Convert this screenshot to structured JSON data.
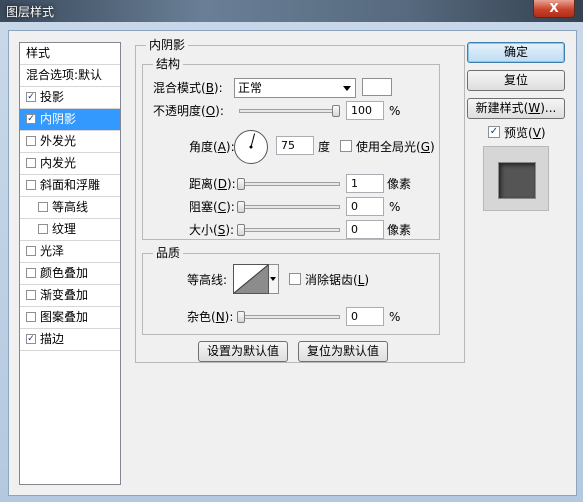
{
  "window": {
    "title": "图层样式",
    "close_label": "X"
  },
  "styles_list": {
    "header": "样式",
    "blend_options": "混合选项:默认",
    "items": [
      {
        "label": "投影",
        "checked": true
      },
      {
        "label": "内阴影",
        "checked": true,
        "selected": true
      },
      {
        "label": "外发光",
        "checked": false
      },
      {
        "label": "内发光",
        "checked": false
      },
      {
        "label": "斜面和浮雕",
        "checked": false
      },
      {
        "label": "等高线",
        "checked": false
      },
      {
        "label": "纹理",
        "checked": false
      },
      {
        "label": "光泽",
        "checked": false
      },
      {
        "label": "颜色叠加",
        "checked": false
      },
      {
        "label": "渐变叠加",
        "checked": false
      },
      {
        "label": "图案叠加",
        "checked": false
      },
      {
        "label": "描边",
        "checked": true
      }
    ]
  },
  "panel": {
    "title": "内阴影",
    "structure": {
      "title": "结构",
      "blend_mode_label": "混合模式(",
      "blend_mode_key": "B",
      "blend_mode_suffix": "):",
      "blend_mode_value": "正常",
      "blend_color": "#ffffff",
      "opacity_label": "不透明度(",
      "opacity_key": "O",
      "opacity_suffix": "):",
      "opacity_value": "100",
      "opacity_unit": "%",
      "opacity_level": 1.0,
      "angle_label": "角度(",
      "angle_key": "A",
      "angle_suffix": "):",
      "angle_value": "75",
      "angle_unit": "度",
      "global_light_label": "使用全局光(",
      "global_light_key": "G",
      "global_light_suffix": ")",
      "global_light_checked": false,
      "distance_label": "距离(",
      "distance_key": "D",
      "distance_suffix": "):",
      "distance_value": "1",
      "distance_unit": "像素",
      "choke_label": "阻塞(",
      "choke_key": "C",
      "choke_suffix": "):",
      "choke_value": "0",
      "choke_unit": "%",
      "size_label": "大小(",
      "size_key": "S",
      "size_suffix": "):",
      "size_value": "0",
      "size_unit": "像素"
    },
    "quality": {
      "title": "品质",
      "contour_label": "等高线:",
      "antialias_label": "消除锯齿(",
      "antialias_key": "L",
      "antialias_suffix": ")",
      "antialias_checked": false,
      "noise_label": "杂色(",
      "noise_key": "N",
      "noise_suffix": "):",
      "noise_value": "0",
      "noise_unit": "%"
    },
    "make_default_label": "设置为默认值",
    "reset_default_label": "复位为默认值"
  },
  "buttons": {
    "ok_label": "确定",
    "reset_label": "复位",
    "new_style_label": "新建样式(",
    "new_style_key": "W",
    "new_style_suffix": ")...",
    "preview_label": "预览(",
    "preview_key": "V",
    "preview_suffix": ")",
    "preview_checked": true
  }
}
